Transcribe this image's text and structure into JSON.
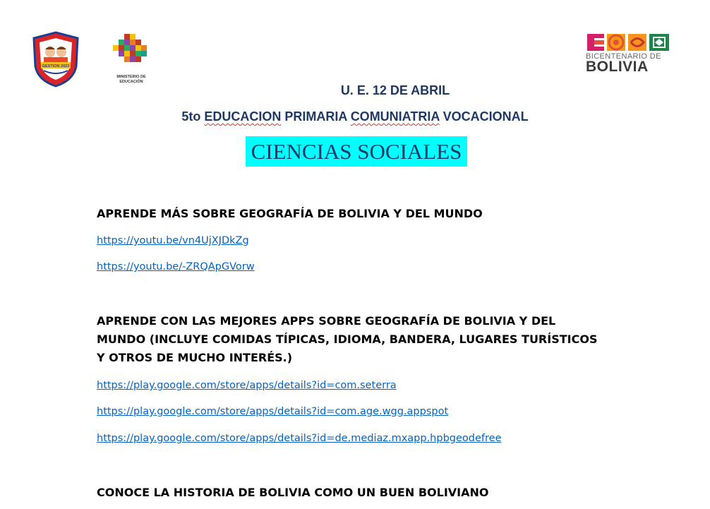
{
  "header": {
    "crest_text": "GESTION 2023",
    "ministry_text": "MINISTERIO DE EDUCACIÓN",
    "bicentenario_line1": "BICENTENARIO DE",
    "bicentenario_line2": "BOLIVIA"
  },
  "school": {
    "name": "U. E. 12 DE ABRIL",
    "grade_prefix": "5to ",
    "grade_word1": "EDUCACION",
    "grade_mid": " PRIMARIA ",
    "grade_word2": "COMUNIATRIA",
    "grade_suffix": " VOCACIONAL"
  },
  "subject": "CIENCIAS SOCIALES",
  "sections": [
    {
      "heading": "APRENDE MÁS SOBRE GEOGRAFÍA DE BOLIVIA Y DEL MUNDO",
      "links": [
        "https://youtu.be/vn4UjXJDkZg",
        "https://youtu.be/-ZRQApGVorw"
      ]
    },
    {
      "heading": "APRENDE CON LAS MEJORES APPS SOBRE GEOGRAFÍA DE BOLIVIA Y DEL MUNDO (INCLUYE COMIDAS TÍPICAS, IDIOMA, BANDERA, LUGARES TURÍSTICOS Y OTROS DE MUCHO INTERÉS.)",
      "links": [
        "https://play.google.com/store/apps/details?id=com.seterra",
        "https://play.google.com/store/apps/details?id=com.age.wgg.appspot",
        "https://play.google.com/store/apps/details?id=de.mediaz.mxapp.hpbgeodefree"
      ]
    },
    {
      "heading": "CONOCE LA HISTORIA DE BOLIVIA COMO UN BUEN BOLIVIANO",
      "links": []
    }
  ],
  "colors": {
    "title_blue": "#1f3864",
    "link_blue": "#0563c1",
    "subject_highlight": "#00ffff"
  }
}
